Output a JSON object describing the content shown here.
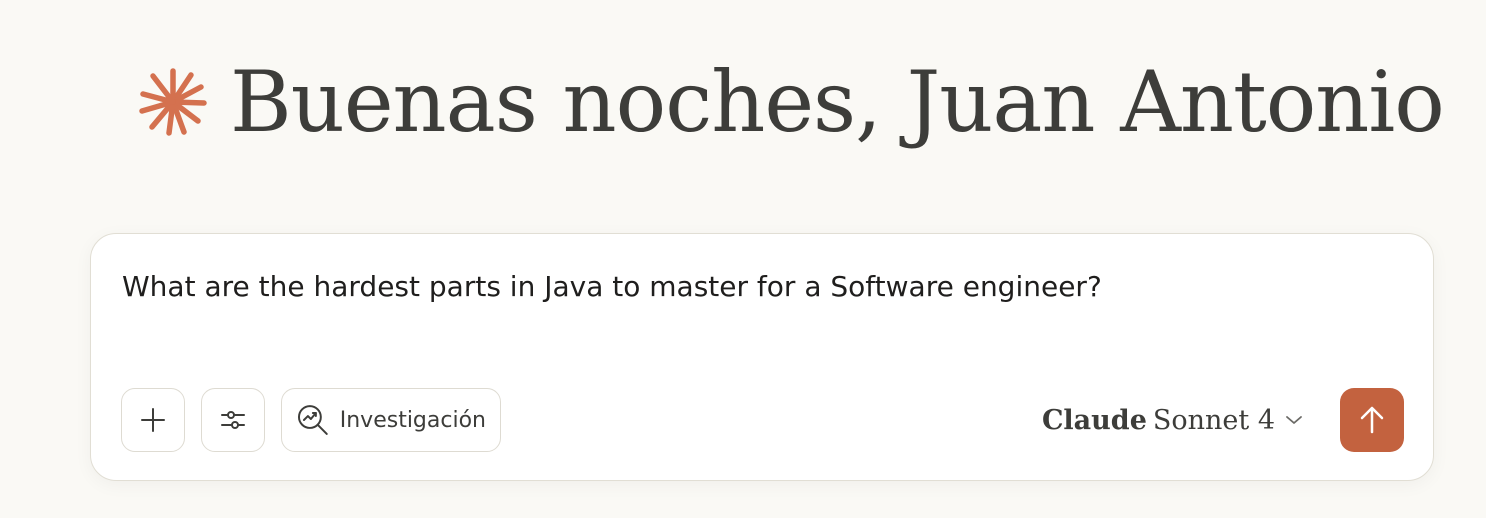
{
  "greeting": {
    "text": "Buenas noches, Juan Antonio",
    "icon": "spark-icon"
  },
  "composer": {
    "input_value": "What are the hardest parts in Java to master for a Software engineer?",
    "add_icon": "plus-icon",
    "settings_icon": "sliders-icon",
    "research": {
      "icon": "research-icon",
      "label": "Investigación"
    },
    "model": {
      "brand": "Claude",
      "name": "Sonnet 4",
      "icon": "chevron-down-icon"
    },
    "send_icon": "arrow-up-icon"
  },
  "colors": {
    "background": "#faf9f5",
    "accent": "#c3623f",
    "text": "#3d3d3a"
  }
}
